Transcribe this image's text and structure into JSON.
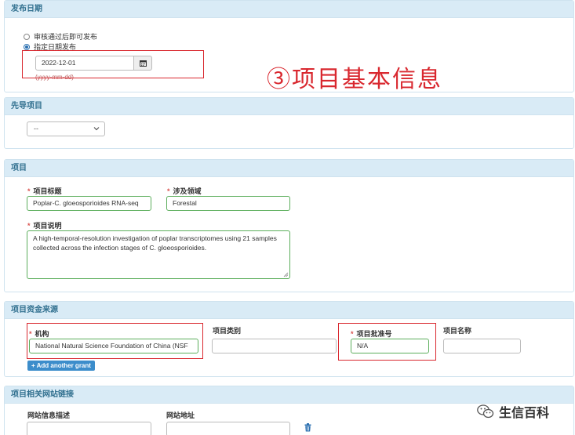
{
  "publish": {
    "heading": "发布日期",
    "options": [
      "审核通过后即可发布",
      "指定日期发布"
    ],
    "selected_index": 1,
    "date_value": "2022-12-01",
    "date_hint": "(yyyy-mm-dd)",
    "calendar_icon": "calendar-icon"
  },
  "annotation": "③项目基本信息",
  "lead_project": {
    "heading": "先导项目",
    "select_value": "--"
  },
  "project": {
    "heading": "项目",
    "title_label": "项目标题",
    "title_value": "Poplar-C. gloeosporioides RNA-seq",
    "domain_label": "涉及领域",
    "domain_value": "Forestal",
    "desc_label": "项目说明",
    "desc_value": "A high-temporal-resolution investigation of poplar transcriptomes using 21 samples collected across the infection stages of C. gloeosporioides."
  },
  "funding": {
    "heading": "项目资金来源",
    "agency_label": "机构",
    "agency_value": "National Natural Science Foundation of China (NSF",
    "category_label": "项目类别",
    "category_value": "",
    "grant_label": "项目批准号",
    "grant_value": "N/A",
    "name_label": "项目名称",
    "name_value": "",
    "add_button": "+ Add another grant"
  },
  "links": {
    "heading": "项目相关网站链接",
    "desc_label": "网站信息描述",
    "url_label": "网站地址",
    "trash_icon": "trash-icon"
  },
  "watermark": {
    "text": "生信百科",
    "icon": "wechat-icon"
  },
  "colors": {
    "panel_header_bg": "#d9ebf6",
    "panel_header_text": "#31708f",
    "required_star": "#d9534f",
    "annotation_red": "#d9282f",
    "valid_green": "#5cae5c",
    "button_blue": "#3c8dcb"
  }
}
